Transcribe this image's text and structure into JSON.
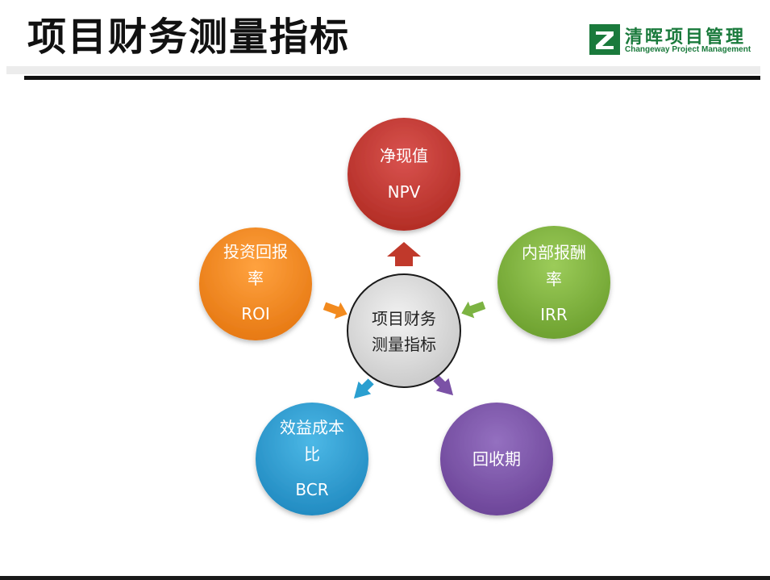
{
  "slide": {
    "title": "项目财务测量指标"
  },
  "logo": {
    "name_cn": "清晖项目管理",
    "name_en": "Changeway Project Management",
    "color": "#1a7a3c"
  },
  "diagram": {
    "center": {
      "line1": "项目财务",
      "line2": "测量指标"
    },
    "nodes": [
      {
        "id": "npv",
        "line1": "净现值",
        "line2": "NPV",
        "color": "#c0392b"
      },
      {
        "id": "irr",
        "line1": "内部报酬",
        "line2": "率",
        "line3": "IRR",
        "color": "#7cb342"
      },
      {
        "id": "payback",
        "line1": "回收期",
        "color": "#7b52a6"
      },
      {
        "id": "bcr",
        "line1": "效益成本",
        "line2": "比",
        "line3": "BCR",
        "color": "#2a9fd0"
      },
      {
        "id": "roi",
        "line1": "投资回报",
        "line2": "率",
        "line3": "ROI",
        "color": "#f28a1e"
      }
    ]
  }
}
